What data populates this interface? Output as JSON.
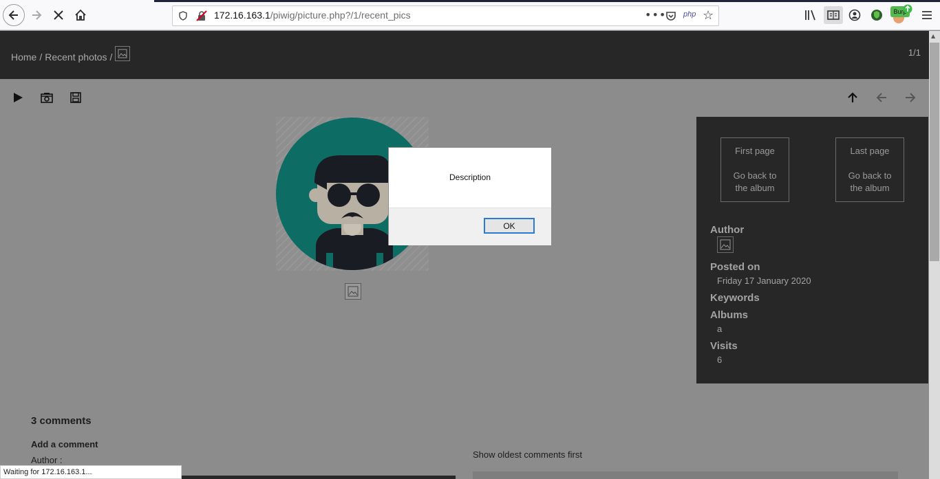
{
  "browser": {
    "url_host": "172.16.163.1",
    "url_path": "/piwig/picture.php?/1/recent_pics",
    "php_badge": "php",
    "burp_label": "Burp",
    "status_text": "Waiting for 172.16.163.1..."
  },
  "header": {
    "breadcrumb": {
      "home": "Home",
      "separator": "/",
      "recent": "Recent photos"
    },
    "counter": "1/1"
  },
  "nav": {
    "first": {
      "title": "First page",
      "link": "Go back to the album"
    },
    "last": {
      "title": "Last page",
      "link": "Go back to the album"
    }
  },
  "info": {
    "author_label": "Author",
    "posted_label": "Posted on",
    "posted_value": "Friday 17 January 2020",
    "keywords_label": "Keywords",
    "albums_label": "Albums",
    "albums_value": "a",
    "visits_label": "Visits",
    "visits_value": "6"
  },
  "comments": {
    "title": "3 comments",
    "add": "Add a comment",
    "author_field": "Author :",
    "order_link": "Show oldest comments first"
  },
  "modal": {
    "message": "Description",
    "ok_label": "OK"
  },
  "colors": {
    "header_bg": "#272727",
    "page_bg": "#8c8c8c",
    "avatar_bg": "#0d6c64",
    "focus_ring": "#2b7ad1"
  }
}
